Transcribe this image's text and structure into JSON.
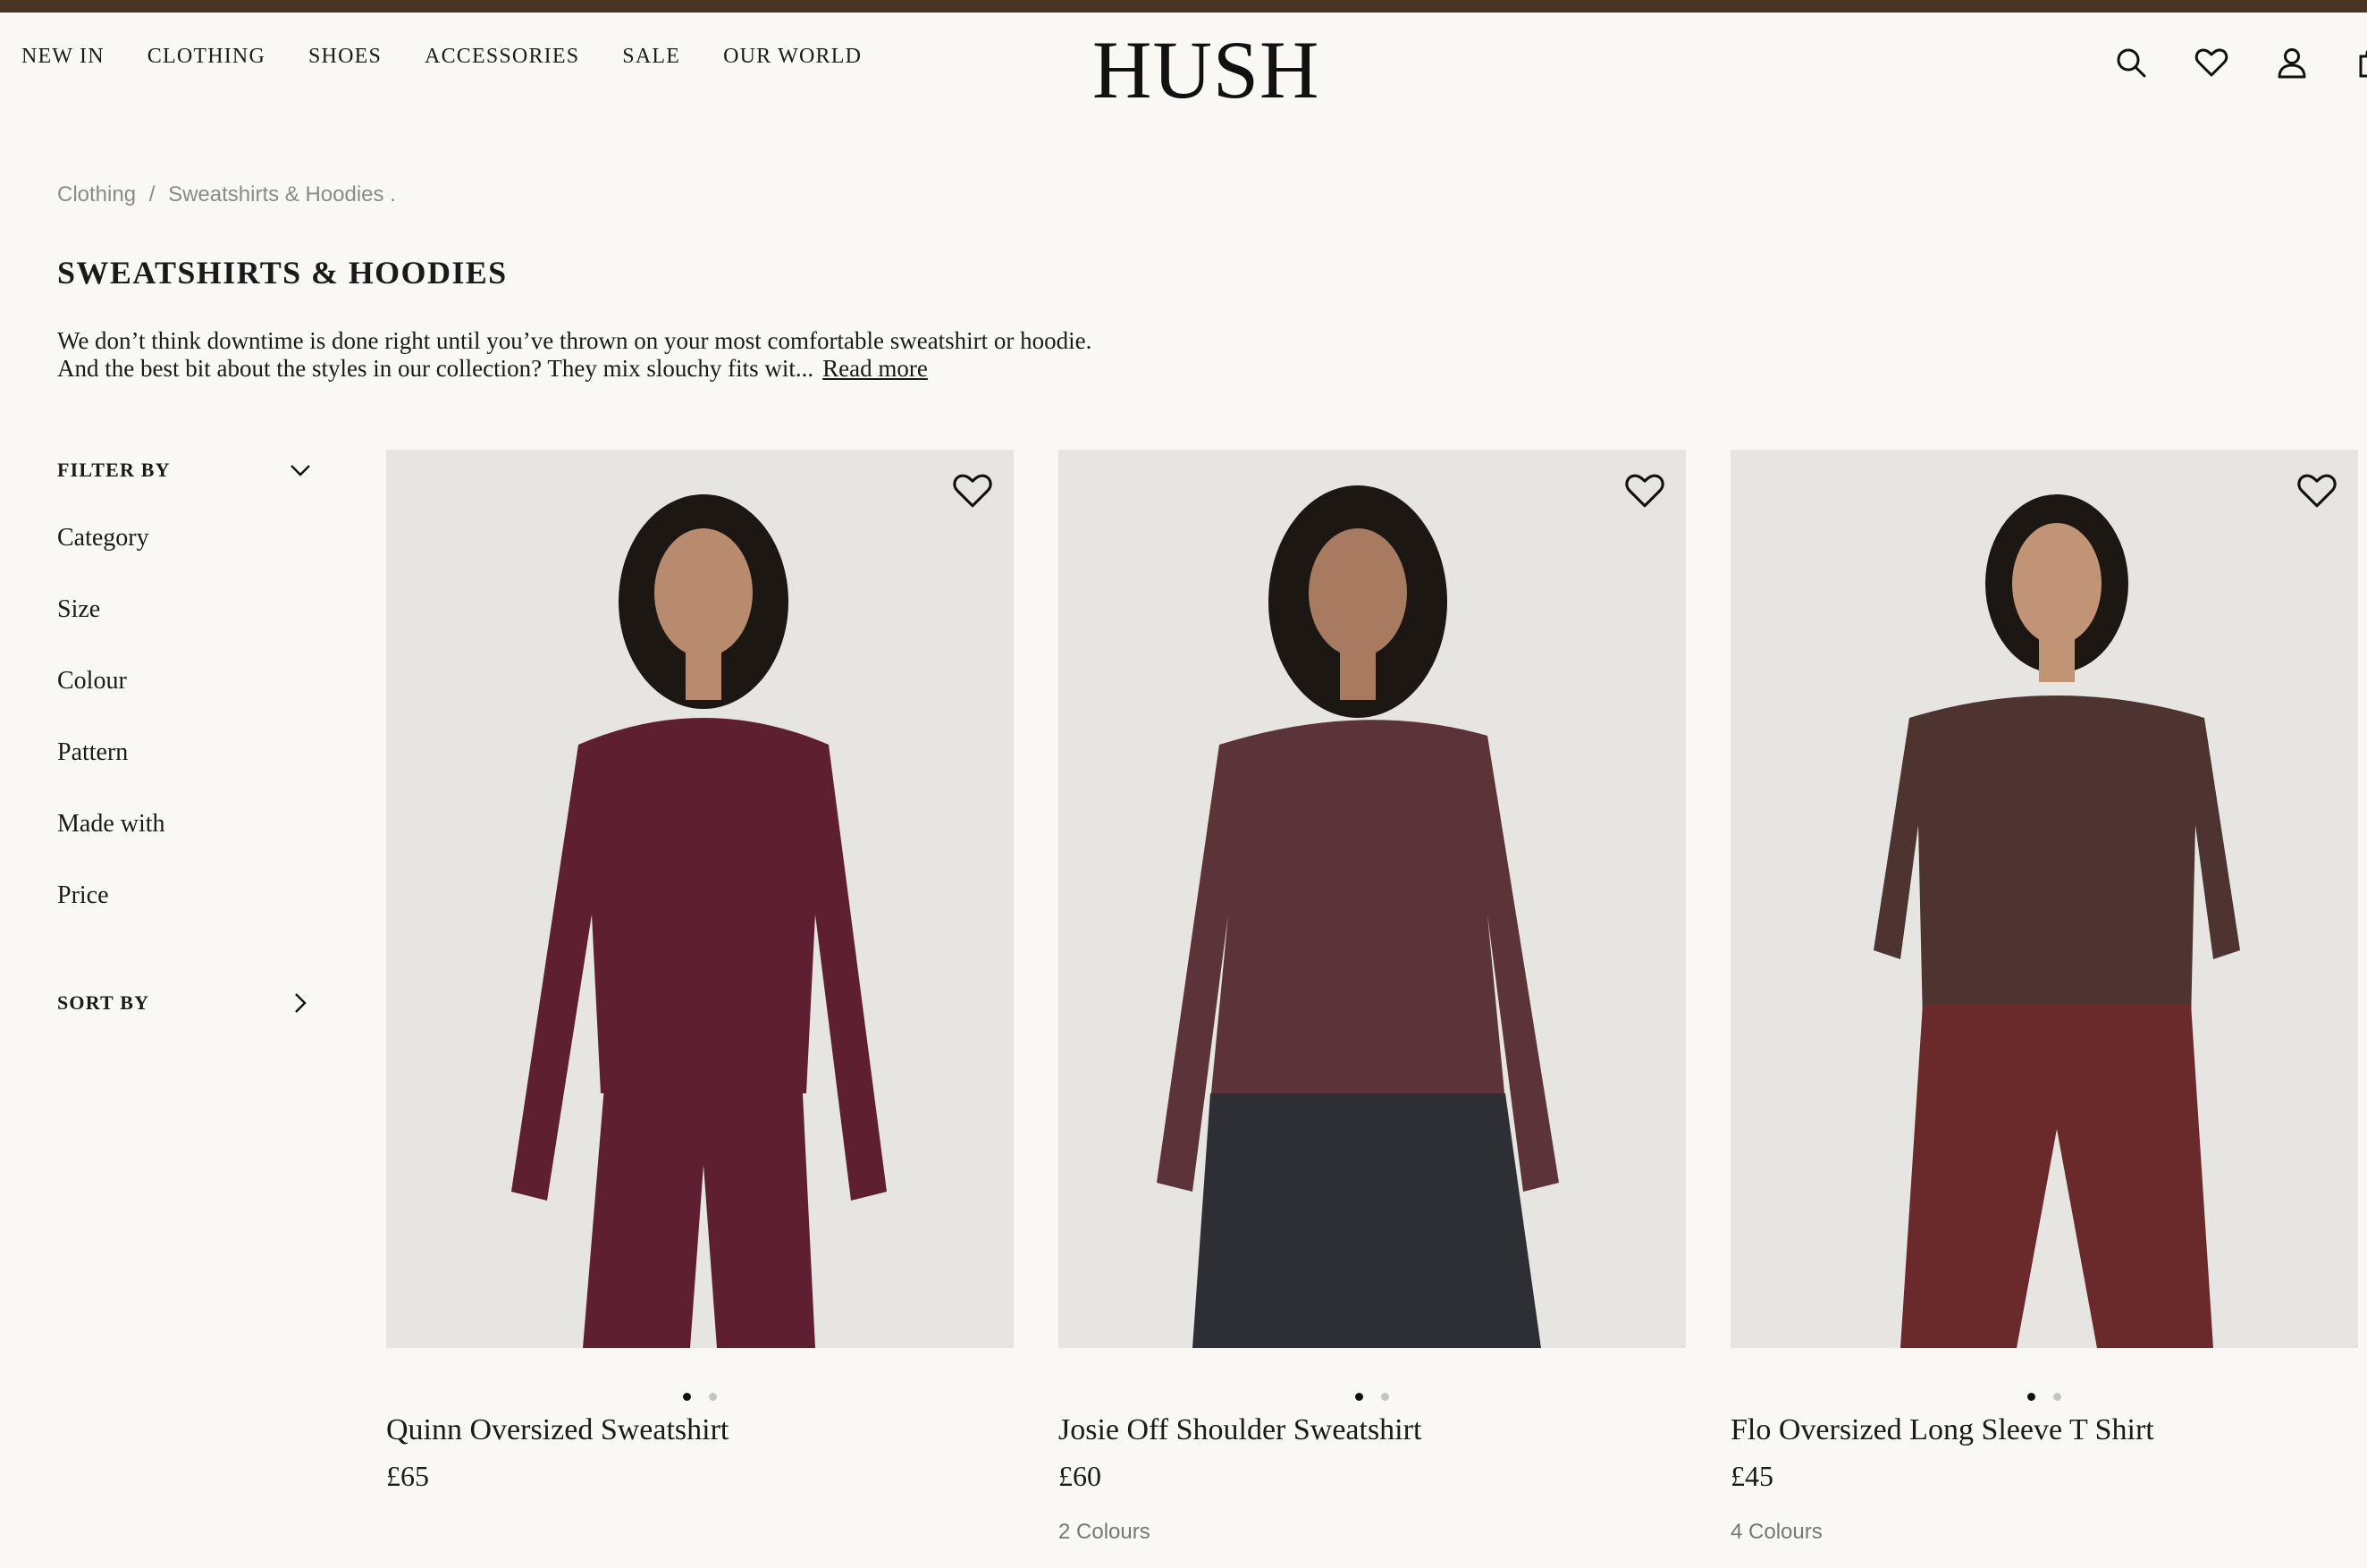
{
  "header": {
    "nav": [
      "NEW IN",
      "CLOTHING",
      "SHOES",
      "ACCESSORIES",
      "SALE",
      "OUR WORLD"
    ],
    "logo": "HUSH",
    "icons": [
      "search-icon",
      "heart-icon",
      "account-icon",
      "bag-icon"
    ]
  },
  "breadcrumb": {
    "items": [
      "Clothing",
      "/",
      "Sweatshirts & Hoodies ."
    ]
  },
  "page": {
    "title": "SWEATSHIRTS & HOODIES",
    "description": "We don’t think downtime is done right until you’ve thrown on your most comfortable sweatshirt or hoodie. And the best bit about the styles in our collection? They mix slouchy fits wit...",
    "read_more": "Read more"
  },
  "sidebar": {
    "filter_label": "FILTER BY",
    "filters": [
      "Category",
      "Size",
      "Colour",
      "Pattern",
      "Made with",
      "Price"
    ],
    "sort_label": "SORT BY"
  },
  "products": [
    {
      "name": "Quinn Oversized Sweatshirt",
      "price": "£65",
      "colours": "",
      "top_color": "#5e1f33",
      "bottom_color": "#5e1f33"
    },
    {
      "name": "Josie Off Shoulder Sweatshirt",
      "price": "£60",
      "colours": "2 Colours",
      "top_color": "#5b3338",
      "bottom_color": "#2e2f35"
    },
    {
      "name": "Flo Oversized Long Sleeve T Shirt",
      "price": "£45",
      "colours": "4 Colours",
      "top_color": "#4e3430",
      "bottom_color": "#6a2a2c"
    }
  ],
  "colors": {
    "topbar": "#4a3424",
    "background": "#f9f8f5"
  }
}
